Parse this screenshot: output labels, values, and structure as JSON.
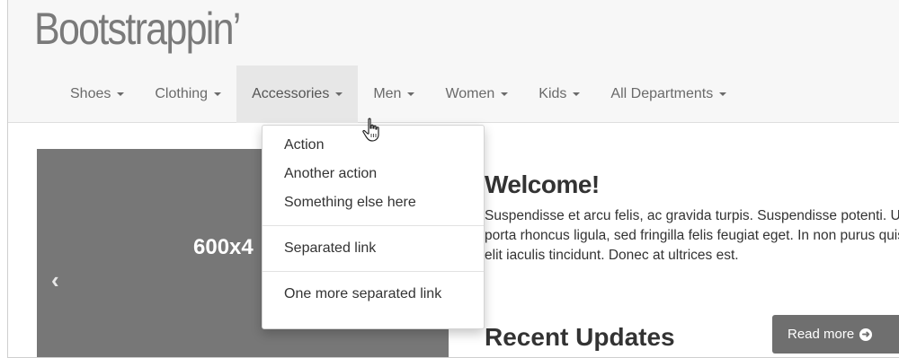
{
  "brand": "Bootstrappin’",
  "nav": {
    "items": [
      {
        "label": "Shoes"
      },
      {
        "label": "Clothing"
      },
      {
        "label": "Accessories"
      },
      {
        "label": "Men"
      },
      {
        "label": "Women"
      },
      {
        "label": "Kids"
      },
      {
        "label": "All Departments"
      }
    ],
    "active_index": 2
  },
  "dropdown": {
    "items": [
      "Action",
      "Another action",
      "Something else here"
    ],
    "separated": [
      "Separated link"
    ],
    "more_separated": [
      "One more separated link"
    ]
  },
  "carousel": {
    "label": "600x4",
    "prev_icon": "chevron-left-icon"
  },
  "content": {
    "heading": "Welcome!",
    "text": "Suspendisse et arcu felis, ac gravida turpis. Suspendisse potenti. Ut porta rhoncus ligula, sed fringilla felis feugiat eget. In non purus quis elit iaculis tincidunt. Donec at ultrices est.",
    "updates_heading": "Recent Updates",
    "read_more": "Read more",
    "read_more_icon": "arrow-circle-right-icon"
  },
  "colors": {
    "header_bg": "#f7f7f7",
    "active_tab_bg": "#e7e7e7",
    "carousel_bg": "#777777",
    "button_bg": "#6f6f6f"
  }
}
